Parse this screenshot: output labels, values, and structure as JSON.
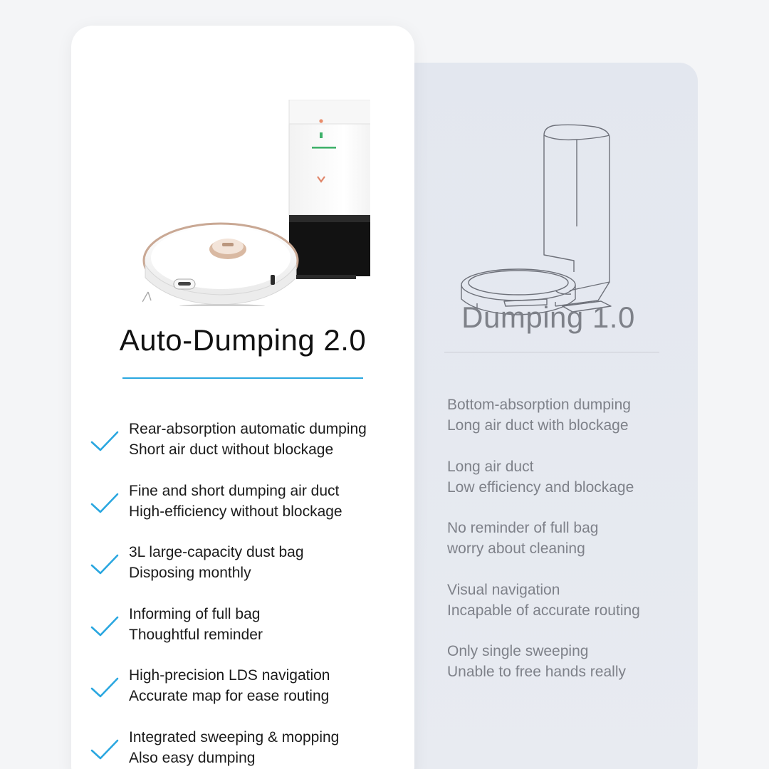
{
  "new_panel": {
    "title": "Auto-Dumping 2.0",
    "accent_color": "#2aa7e0",
    "product_image": "robot-vacuum-with-auto-empty-station",
    "features": [
      {
        "line1": "Rear-absorption automatic dumping",
        "line2": "Short air duct without blockage"
      },
      {
        "line1": "Fine and short dumping air duct",
        "line2": "High-efficiency without blockage"
      },
      {
        "line1": "3L large-capacity dust bag",
        "line2": "Disposing monthly"
      },
      {
        "line1": "Informing of full bag",
        "line2": "Thoughtful reminder"
      },
      {
        "line1": "High-precision LDS navigation",
        "line2": "Accurate map for ease routing"
      },
      {
        "line1": "Integrated sweeping & mopping",
        "line2": "Also easy dumping"
      }
    ]
  },
  "old_panel": {
    "title": "Dumping 1.0",
    "product_image": "line-drawing-robot-vacuum-with-station",
    "features": [
      {
        "line1": "Bottom-absorption dumping",
        "line2": "Long air duct with blockage"
      },
      {
        "line1": "Long air duct",
        "line2": "Low efficiency and blockage"
      },
      {
        "line1": "No reminder of full bag",
        "line2": "worry about cleaning"
      },
      {
        "line1": "Visual navigation",
        "line2": "Incapable of accurate routing"
      },
      {
        "line1": "Only single sweeping",
        "line2": "Unable to free hands really"
      }
    ]
  }
}
